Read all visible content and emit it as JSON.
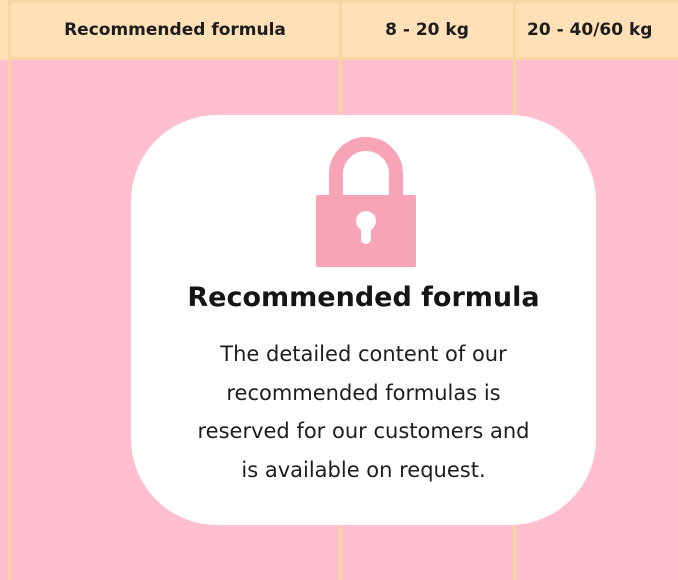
{
  "table": {
    "columns": [
      "Recommended formula",
      "8 - 20 kg",
      "20 - 40/60 kg"
    ]
  },
  "colors": {
    "page_background": "#ffbfce",
    "header_background": "#ffe0b7",
    "grid_lines": "#f8d6a2",
    "card_background": "#ffffff",
    "lock_icon": "#f7a5b6"
  },
  "locked_overlay": {
    "icon": "lock-icon",
    "title": "Recommended formula",
    "message_lines": [
      "The detailed content of our",
      "recommended formulas is",
      "reserved for our customers and",
      "is available on request."
    ]
  }
}
